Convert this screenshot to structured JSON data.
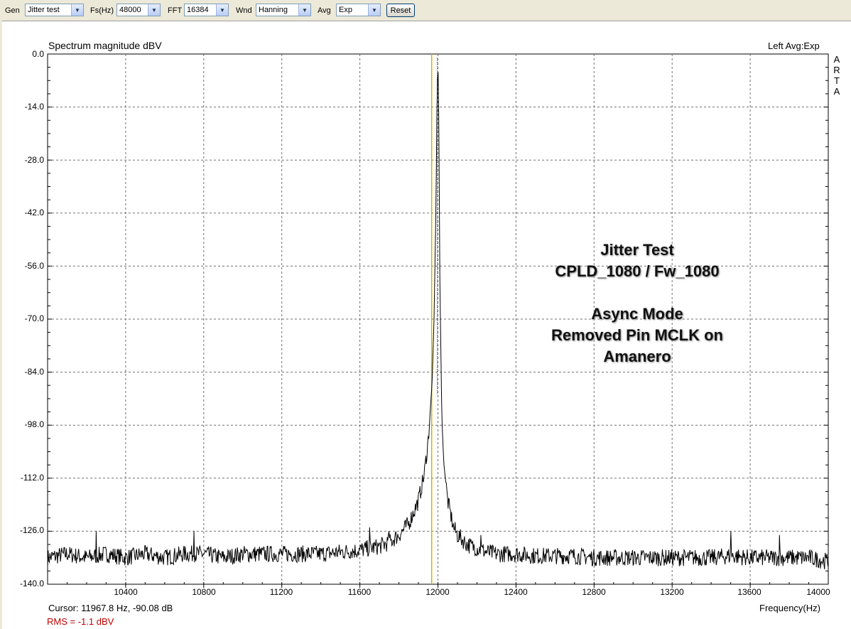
{
  "toolbar": {
    "gen_label": "Gen",
    "gen_value": "Jitter test",
    "fs_label": "Fs(Hz)",
    "fs_value": "48000",
    "fft_label": "FFT",
    "fft_value": "16384",
    "wnd_label": "Wnd",
    "wnd_value": "Hanning",
    "avg_label": "Avg",
    "avg_value": "Exp",
    "reset_label": "Reset"
  },
  "plot": {
    "title": "Spectrum magnitude dBV",
    "info": "Left  Avg:Exp",
    "brand_letters": [
      "A",
      "R",
      "T",
      "A"
    ],
    "cursor_text": "Cursor: 11967.8 Hz, -90.08 dB",
    "x_axis_label": "Frequency(Hz)",
    "rms_text": "RMS =   -1.1 dBV",
    "annotation": [
      "Jitter Test",
      "CPLD_1080 / Fw_1080",
      "",
      "Async Mode",
      "Removed Pin MCLK on",
      "Amanero"
    ]
  },
  "chart_data": {
    "type": "line",
    "title": "Spectrum magnitude dBV",
    "xlabel": "Frequency(Hz)",
    "ylabel": "",
    "xlim": [
      10000,
      14000
    ],
    "ylim": [
      -140,
      0
    ],
    "x_ticks": [
      "10400",
      "10800",
      "11200",
      "11600",
      "12000",
      "12400",
      "12800",
      "13200",
      "13600",
      "14000"
    ],
    "y_ticks": [
      "0.0",
      "-14.0",
      "-28.0",
      "-42.0",
      "-56.0",
      "-70.0",
      "-84.0",
      "-98.0",
      "-112.0",
      "-126.0",
      "-140.0"
    ],
    "grid": true,
    "cursor_freq": 11967.8,
    "cursor_level": -90.08,
    "series": [
      {
        "x": [
          10000,
          10100,
          10200,
          10300,
          10400,
          10500,
          10600,
          10700,
          10800,
          10900,
          11000,
          11100,
          11200,
          11300,
          11400,
          11500,
          11600,
          11700,
          11750,
          11800,
          11850,
          11900,
          11930,
          11950,
          11970,
          11980,
          11990,
          11995,
          12000,
          12005,
          12010,
          12020,
          12030,
          12050,
          12080,
          12100,
          12150,
          12200,
          12250,
          12300,
          12400,
          12500,
          12600,
          12700,
          12800,
          12900,
          13000,
          13100,
          13200,
          13300,
          13400,
          13500,
          13600,
          13700,
          13800,
          13900,
          14000
        ],
        "y": [
          -133,
          -132,
          -133,
          -132,
          -133,
          -132,
          -133,
          -132,
          -132,
          -133,
          -132,
          -132,
          -132,
          -132,
          -132,
          -131.5,
          -131,
          -130,
          -129,
          -127,
          -124,
          -118,
          -111,
          -102,
          -87,
          -70,
          -40,
          -15,
          -1,
          -20,
          -60,
          -96,
          -108,
          -118,
          -125,
          -127,
          -129.5,
          -130.5,
          -131.5,
          -132,
          -132,
          -132.5,
          -132.5,
          -132.5,
          -133,
          -133,
          -133,
          -133,
          -133,
          -133,
          -133,
          -132.5,
          -133,
          -133,
          -133,
          -133,
          -134
        ]
      }
    ],
    "spikes": [
      {
        "x": 10250,
        "y": -126
      },
      {
        "x": 10750,
        "y": -126
      },
      {
        "x": 11650,
        "y": -125
      },
      {
        "x": 11750,
        "y": -126
      },
      {
        "x": 12220,
        "y": -127
      },
      {
        "x": 13500,
        "y": -126
      },
      {
        "x": 13750,
        "y": -127
      }
    ]
  }
}
